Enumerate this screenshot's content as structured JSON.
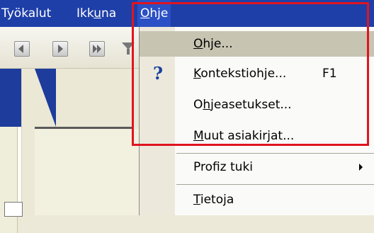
{
  "menubar": {
    "items": [
      {
        "label_pre": "",
        "label_u": "",
        "label_post": "Työkalut"
      },
      {
        "label_pre": "Ikk",
        "label_u": "u",
        "label_post": "na"
      },
      {
        "label_pre": "",
        "label_u": "O",
        "label_post": "hje"
      }
    ]
  },
  "toolbar": {
    "icons": [
      "first-page-icon",
      "next-page-icon",
      "last-page-icon",
      "filter-icon"
    ]
  },
  "menu": {
    "items": [
      {
        "pre": "",
        "u": "O",
        "post": "hje...",
        "shortcut": ""
      },
      {
        "pre": "",
        "u": "K",
        "post": "ontekstiohje...",
        "shortcut": "F1"
      },
      {
        "pre": "O",
        "u": "h",
        "post": "jeasetukset...",
        "shortcut": ""
      },
      {
        "pre": "",
        "u": "M",
        "post": "uut asiakirjat...",
        "shortcut": ""
      },
      {
        "pre": "Profiz tuki",
        "u": "",
        "post": "",
        "shortcut": ""
      },
      {
        "pre": "",
        "u": "T",
        "post": "ietoja",
        "shortcut": ""
      }
    ]
  },
  "colors": {
    "menubar": "#1e3fa8",
    "highlight": "#e0141f",
    "hover": "#c7c4b2"
  }
}
